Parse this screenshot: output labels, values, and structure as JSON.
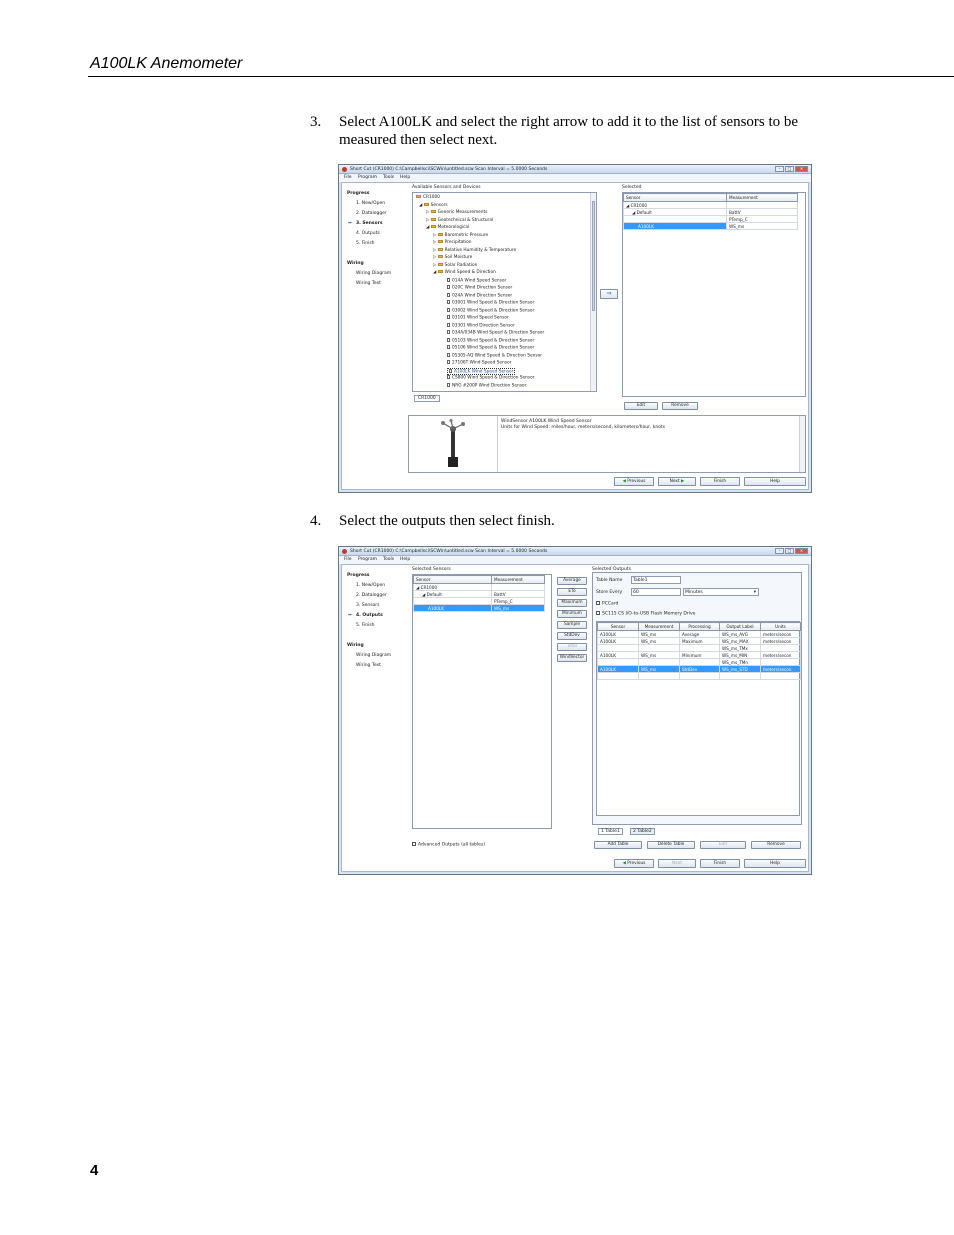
{
  "header": {
    "title": "A100LK Anemometer"
  },
  "steps": [
    {
      "num": "3.",
      "text": "Select A100LK and select the right arrow to add it to the list of sensors to be measured then select next."
    },
    {
      "num": "4.",
      "text": "Select the outputs then select finish."
    }
  ],
  "page_number": "4",
  "common": {
    "title_bar": "Short Cut (CR1000) C:\\Campbellsci\\SCWin\\untitled.scw      Scan Interval = 5.0000 Seconds",
    "menu": [
      "File",
      "Program",
      "Tools",
      "Help"
    ],
    "progress_title": "Progress",
    "wiring_title": "Wiring",
    "wiring_items": [
      "Wiring Diagram",
      "Wiring Text"
    ],
    "nav_buttons": {
      "previous": "Previous",
      "next": "Next",
      "finish": "Finish",
      "help": "Help"
    }
  },
  "shot1": {
    "progress_items": [
      "1. New/Open",
      "2. Datalogger",
      "3. Sensors",
      "4. Outputs",
      "5. Finish"
    ],
    "available_title": "Available Sensors and Devices",
    "tree": [
      "CR1000",
      "Sensors",
      "Generic Measurements",
      "Geotechnical & Structural",
      "Meteorological",
      "Barometric Pressure",
      "Precipitation",
      "Relative Humidity & Temperature",
      "Soil Moisture",
      "Solar Radiation",
      "Wind Speed & Direction",
      "014A Wind Speed Sensor",
      "020C Wind Direction Sensor",
      "024A Wind Direction Sensor",
      "03001 Wind Speed & Direction Sensor",
      "03002 Wind Speed & Direction Sensor",
      "03101 Wind Speed Sensor",
      "03301 Wind Direction Sensor",
      "034A/034B Wind Speed & Direction Sensor",
      "05103 Wind Speed & Direction Sensor",
      "05106 Wind Speed & Direction Sensor",
      "05305-AQ Wind Speed & Direction Sensor",
      "27106T Wind Speed Sensor",
      "A100LK Wind Speed Sensor",
      "CS800 Wind Speed & Direction Sensor",
      "NRG #200P Wind Direction Sensor"
    ],
    "tab": "CR1000",
    "selected_title": "Selected",
    "selected_headers": [
      "Sensor",
      "Measurement"
    ],
    "selected_rows": [
      [
        "CR1000",
        ""
      ],
      [
        "Default",
        "BattV"
      ],
      [
        "",
        "PTemp_C"
      ],
      [
        "A100LK",
        "WS_ms"
      ]
    ],
    "arrow": "⇒",
    "edit": "Edit",
    "remove": "Remove",
    "desc_line1": "WindSensor A100LK Wind Speed Sensor",
    "desc_line2": "Units for Wind Speed: miles/hour, meters/second, kilometers/hour, knots"
  },
  "shot2": {
    "progress_items": [
      "1. New/Open",
      "2. Datalogger",
      "3. Sensors",
      "4. Outputs",
      "5. Finish"
    ],
    "sensors_title": "Selected Sensors",
    "sensor_headers": [
      "Sensor",
      "Measurement"
    ],
    "sensor_rows": [
      [
        "CR1000",
        ""
      ],
      [
        "Default",
        "BattV"
      ],
      [
        "",
        "PTemp_C"
      ],
      [
        "A100LK",
        "WS_ms"
      ]
    ],
    "proc_buttons": [
      "Average",
      "ETo",
      "Maximum",
      "Minimum",
      "Sample",
      "StdDev",
      "Total",
      "WindVector"
    ],
    "outputs_title": "Selected Outputs",
    "table_name_label": "Table Name",
    "table_name": "Table1",
    "store_every_label": "Store Every",
    "store_every": "60",
    "store_units": "Minutes",
    "pccard": "PCCard",
    "sc115": "SC115 CS I/O-to-USB Flash Memory Drive",
    "output_headers": [
      "Sensor",
      "Measurement",
      "Processing",
      "Output Label",
      "Units"
    ],
    "output_rows": [
      [
        "A100LK",
        "WS_ms",
        "Average",
        "WS_ms_AVG",
        "meters/secon"
      ],
      [
        "A100LK",
        "WS_ms",
        "Maximum",
        "WS_ms_MAX",
        "meters/secon"
      ],
      [
        "",
        "",
        "",
        "WS_ms_TMx",
        ""
      ],
      [
        "A100LK",
        "WS_ms",
        "Minimum",
        "WS_ms_MIN",
        "meters/secon"
      ],
      [
        "",
        "",
        "",
        "WS_ms_TMn",
        ""
      ],
      [
        "A100LK",
        "WS_ms",
        "StdDev",
        "WS_ms_STD",
        "meters/secon"
      ]
    ],
    "tabs": [
      "1 Table1",
      "2 Table2"
    ],
    "advanced": "Advanced Outputs (all tables)",
    "add_table": "Add Table",
    "delete_table": "Delete Table",
    "edit": "Edit",
    "remove": "Remove"
  }
}
